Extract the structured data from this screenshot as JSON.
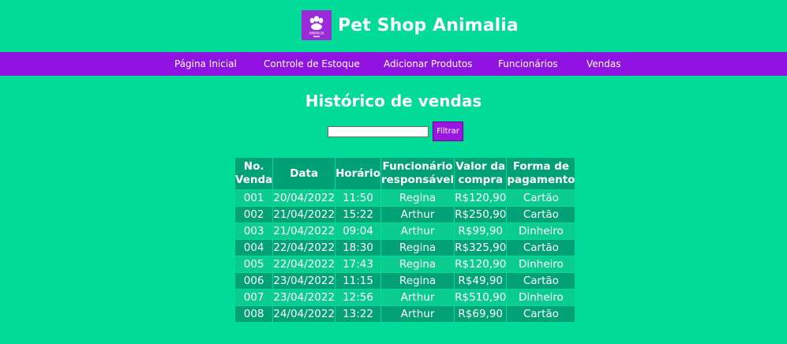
{
  "brand": {
    "title": "Pet Shop Animalia",
    "logo_text": "ANIMALIA",
    "logo_icon": "paw-logo-icon"
  },
  "nav": {
    "items": [
      {
        "label": "Página Inicial"
      },
      {
        "label": "Controle de Estoque"
      },
      {
        "label": "Adicionar Produtos"
      },
      {
        "label": "Funcionários"
      },
      {
        "label": "Vendas"
      }
    ]
  },
  "page": {
    "title": "Histórico de vendas"
  },
  "filter": {
    "value": "",
    "placeholder": "",
    "button_label": "Filtrar"
  },
  "table": {
    "headers": [
      "No. Venda",
      "Data",
      "Horário",
      "Funcionário responsável",
      "Valor da compra",
      "Forma de pagamento"
    ],
    "rows": [
      [
        "001",
        "20/04/2022",
        "11:50",
        "Regina",
        "R$120,90",
        "Cartão"
      ],
      [
        "002",
        "21/04/2022",
        "15:22",
        "Arthur",
        "R$250,90",
        "Cartão"
      ],
      [
        "003",
        "21/04/2022",
        "09:04",
        "Arthur",
        "R$99,90",
        "Dinheiro"
      ],
      [
        "004",
        "22/04/2022",
        "18:30",
        "Regina",
        "R$325,90",
        "Cartão"
      ],
      [
        "005",
        "22/04/2022",
        "17:43",
        "Regina",
        "R$120,90",
        "Dinheiro"
      ],
      [
        "006",
        "23/04/2022",
        "11:15",
        "Regina",
        "R$49,90",
        "Cartão"
      ],
      [
        "007",
        "23/04/2022",
        "12:56",
        "Arthur",
        "R$510,90",
        "Dinheiro"
      ],
      [
        "008",
        "24/04/2022",
        "13:22",
        "Arthur",
        "R$69,90",
        "Cartão"
      ]
    ]
  },
  "colors": {
    "background": "#00db97",
    "nav_background": "#9113e2",
    "accent": "#9b17e0",
    "table_dark": "#00a174",
    "table_light": "#0bcc8f"
  }
}
